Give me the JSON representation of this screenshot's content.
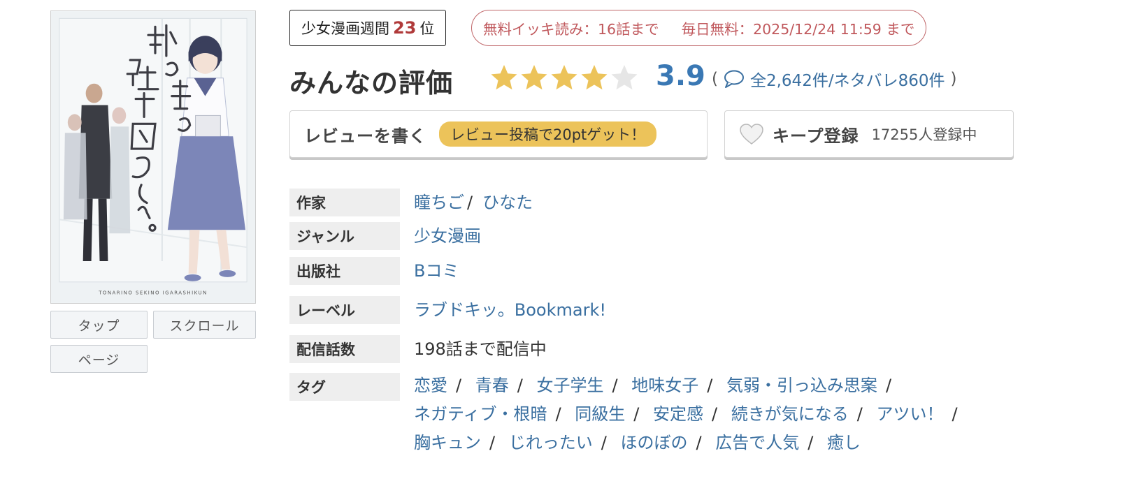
{
  "cover": {
    "title_art": "隣の席の五十嵐くん。",
    "romaji": "TONARINO SEKINO IGARASHIKUN"
  },
  "view_buttons": {
    "tap": "タップ",
    "scroll": "スクロール",
    "page": "ページ"
  },
  "rank": {
    "category": "少女漫画週間",
    "number": "23",
    "suffix": "位"
  },
  "free": {
    "ikki": "無料イッキ読み：16話まで",
    "daily": "毎日無料：2025/12/24 11:59 まで"
  },
  "rating": {
    "title": "みんなの評価",
    "score": "3.9",
    "stars_value": 3.9,
    "stars_max": 5,
    "open_paren": "(",
    "counts": "全2,642件/ネタバレ860件",
    "close_paren": ")",
    "star_color": "#ecc35a",
    "star_empty_color": "#e6e6e6"
  },
  "review_button": {
    "label": "レビューを書く",
    "promo": "レビュー投稿で20ptゲット！"
  },
  "keep_button": {
    "label": "キープ登録",
    "count": "17255人登録中"
  },
  "info": {
    "author_label": "作家",
    "authors": [
      "瞳ちご",
      "ひなた"
    ],
    "author_sep": "/",
    "genre_label": "ジャンル",
    "genre": "少女漫画",
    "publisher_label": "出版社",
    "publisher": "Bコミ",
    "label_label": "レーベル",
    "label": "ラブドキッ。Bookmark!",
    "episodes_label": "配信話数",
    "episodes": "198話まで配信中",
    "tags_label": "タグ",
    "tag_sep": "/",
    "tags": [
      "恋愛",
      "青春",
      "女子学生",
      "地味女子",
      "気弱・引っ込み思案",
      "ネガティブ・根暗",
      "同級生",
      "安定感",
      "続きが気になる",
      "アツい！",
      "胸キュン",
      "じれったい",
      "ほのぼの",
      "広告で人気",
      "癒し"
    ]
  }
}
